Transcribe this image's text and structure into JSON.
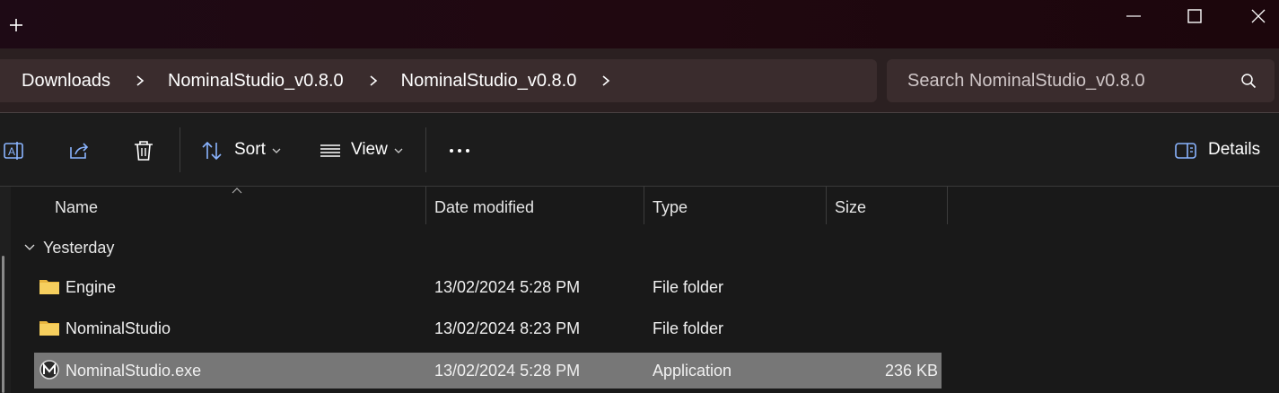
{
  "window": {
    "new_tab_icon": "plus-icon",
    "minimize_icon": "minimize-icon",
    "maximize_icon": "maximize-icon",
    "close_icon": "close-icon"
  },
  "address": {
    "breadcrumbs": [
      "Downloads",
      "NominalStudio_v0.8.0",
      "NominalStudio_v0.8.0"
    ],
    "chevron_icon": "chevron-right-icon"
  },
  "search": {
    "placeholder": "Search NominalStudio_v0.8.0",
    "icon": "search-icon"
  },
  "toolbar": {
    "rename_icon": "rename-icon",
    "share_icon": "share-icon",
    "delete_icon": "trash-icon",
    "sort_label": "Sort",
    "view_label": "View",
    "more_icon": "more-icon",
    "details_label": "Details"
  },
  "columns": {
    "name": "Name",
    "date_modified": "Date modified",
    "type": "Type",
    "size": "Size"
  },
  "group": {
    "label": "Yesterday"
  },
  "rows": [
    {
      "name": "Engine",
      "date": "13/02/2024 5:28 PM",
      "type": "File folder",
      "size": "",
      "icon": "folder-icon",
      "selected": false
    },
    {
      "name": "NominalStudio",
      "date": "13/02/2024 8:23 PM",
      "type": "File folder",
      "size": "",
      "icon": "folder-icon",
      "selected": false
    },
    {
      "name": "NominalStudio.exe",
      "date": "13/02/2024 5:28 PM",
      "type": "Application",
      "size": "236 KB",
      "icon": "app-icon",
      "selected": true
    }
  ],
  "colors": {
    "selection": "#777777",
    "folder": "#f2c14e",
    "breadcrumb_bg": "#3a2c2d"
  }
}
